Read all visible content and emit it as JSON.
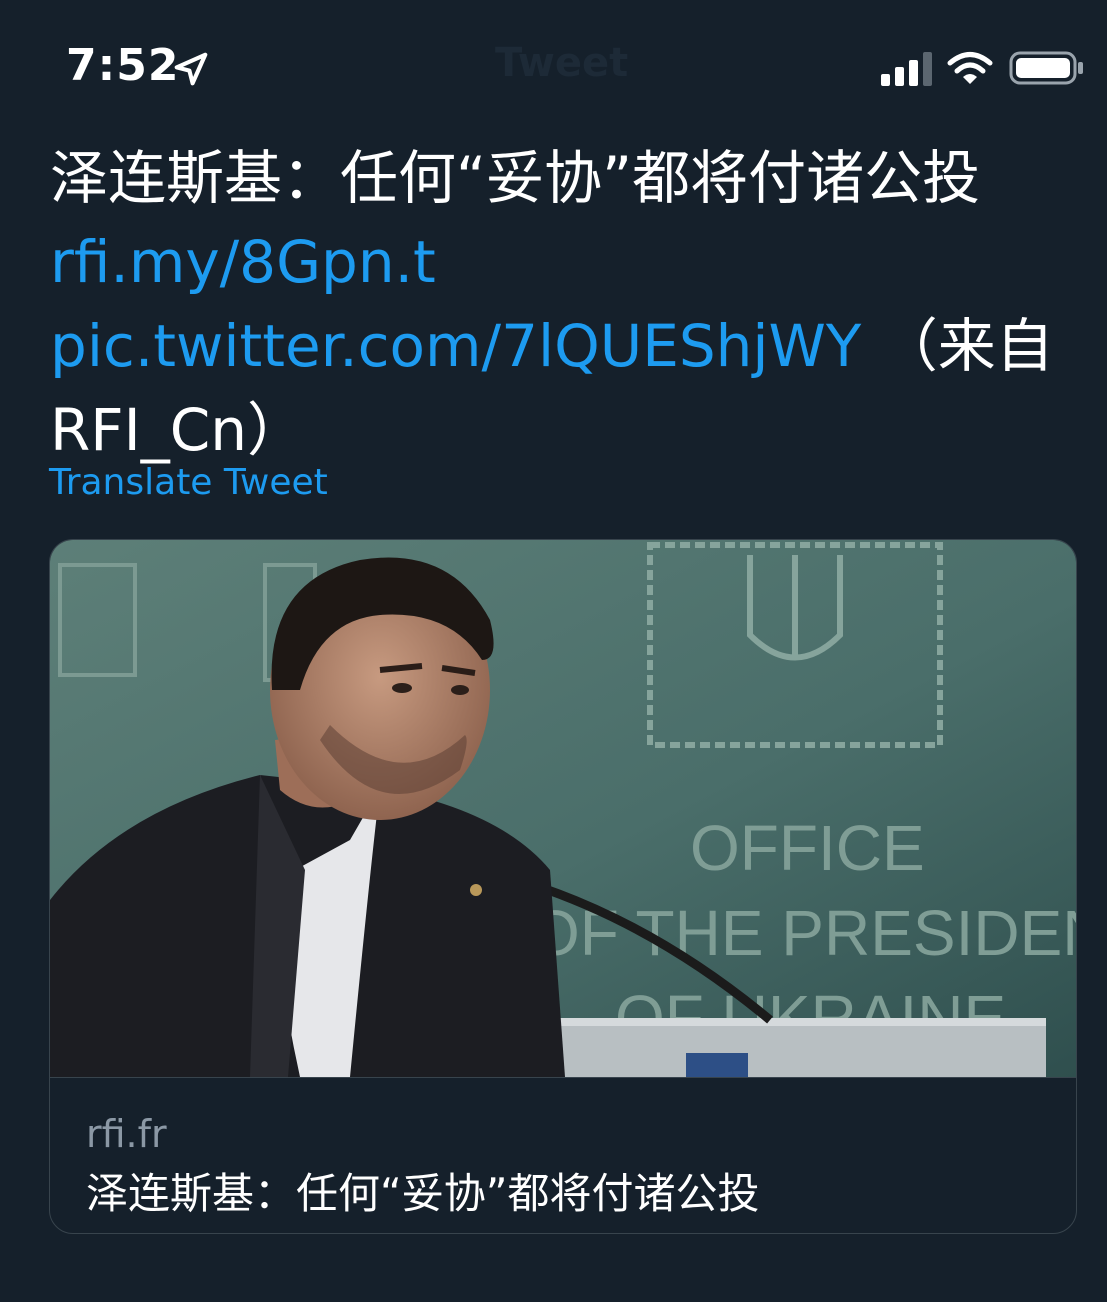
{
  "status_bar": {
    "time": "7:52",
    "nav_title": "Tweet"
  },
  "tweet": {
    "text": "泽连斯基：任何“妥协”都将付诸公投",
    "link_1": "rfi.my/8Gpn.t",
    "link_2": "pic.twitter.com/7lQUEShjWY",
    "source": "（来自 RFI_Cn）",
    "translate_label": "Translate Tweet"
  },
  "card": {
    "image_emblem_text_1": "OFFICE",
    "image_emblem_text_2": "OF THE PRESIDENT",
    "image_emblem_text_3": "OF UKRAINE",
    "domain": "rfi.fr",
    "title": "泽连斯基：任何“妥协”都将付诸公投"
  },
  "colors": {
    "background": "#15202b",
    "link": "#1d9bf0",
    "secondary_text": "#8b98a5",
    "border": "#38444d"
  }
}
